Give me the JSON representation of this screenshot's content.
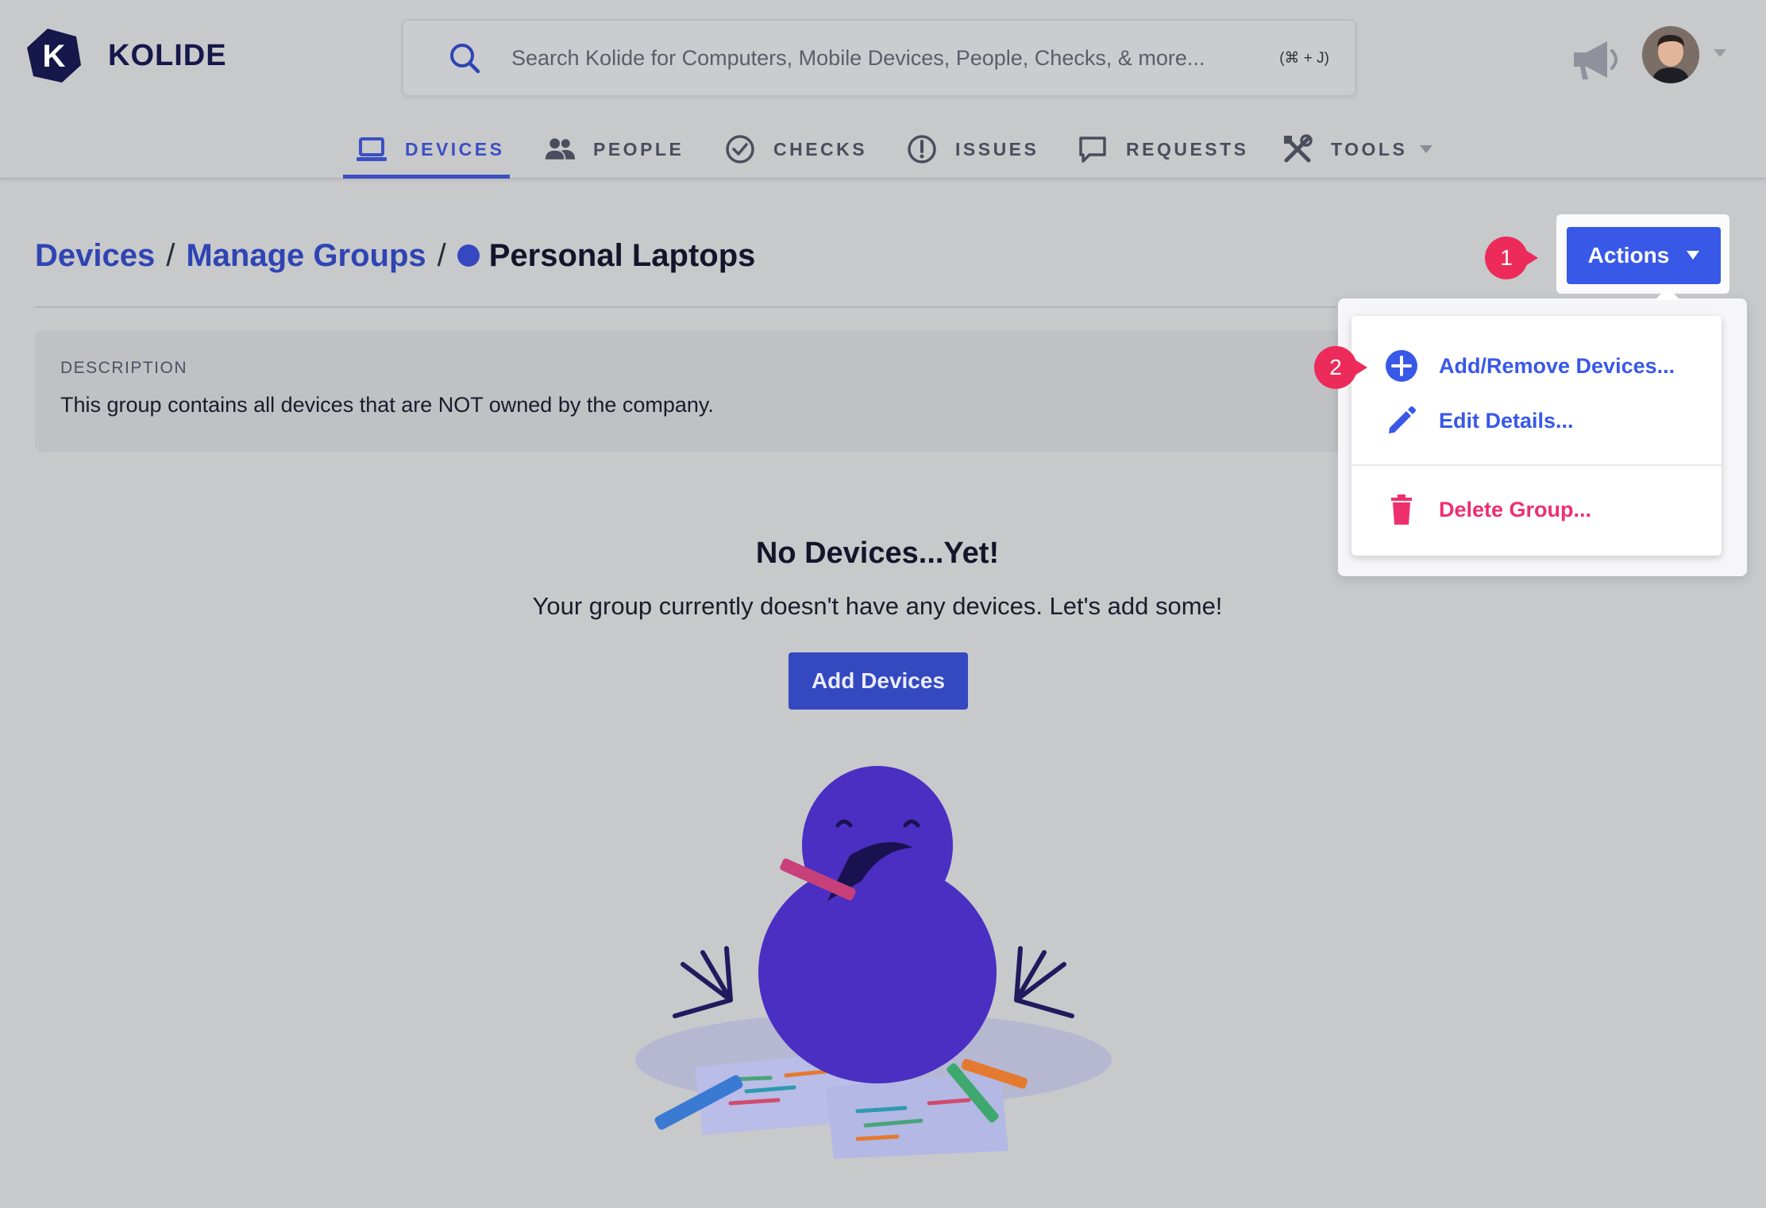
{
  "app": {
    "logo_text": "KOLIDE"
  },
  "search": {
    "placeholder": "Search Kolide for Computers, Mobile Devices, People, Checks, & more...",
    "shortcut": "(⌘ + J)"
  },
  "nav": {
    "items": [
      {
        "label": "DEVICES",
        "icon": "laptop-icon",
        "active": true
      },
      {
        "label": "PEOPLE",
        "icon": "people-icon"
      },
      {
        "label": "CHECKS",
        "icon": "check-circle-icon"
      },
      {
        "label": "ISSUES",
        "icon": "alert-circle-icon"
      },
      {
        "label": "REQUESTS",
        "icon": "chat-bubble-icon"
      },
      {
        "label": "TOOLS",
        "icon": "tools-icon",
        "has_dropdown": true
      }
    ]
  },
  "breadcrumb": {
    "devices": "Devices",
    "sep1": "/",
    "manage_groups": "Manage Groups",
    "sep2": "/",
    "current": "Personal Laptops",
    "group_color": "#3548c0"
  },
  "description": {
    "label": "DESCRIPTION",
    "text": "This group contains all devices that are NOT owned by the company."
  },
  "empty_state": {
    "title": "No Devices...Yet!",
    "subtitle": "Your group currently doesn't have any devices. Let's add some!",
    "button": "Add Devices"
  },
  "actions": {
    "button_label": "Actions",
    "menu": {
      "add_remove": "Add/Remove Devices...",
      "edit": "Edit Details...",
      "delete": "Delete Group..."
    }
  },
  "annotations": {
    "badge1": "1",
    "badge2": "2"
  },
  "colors": {
    "accent": "#3858e8",
    "danger": "#ee2f6e",
    "badge": "#ec2b5b",
    "brand_navy": "#16174a"
  }
}
